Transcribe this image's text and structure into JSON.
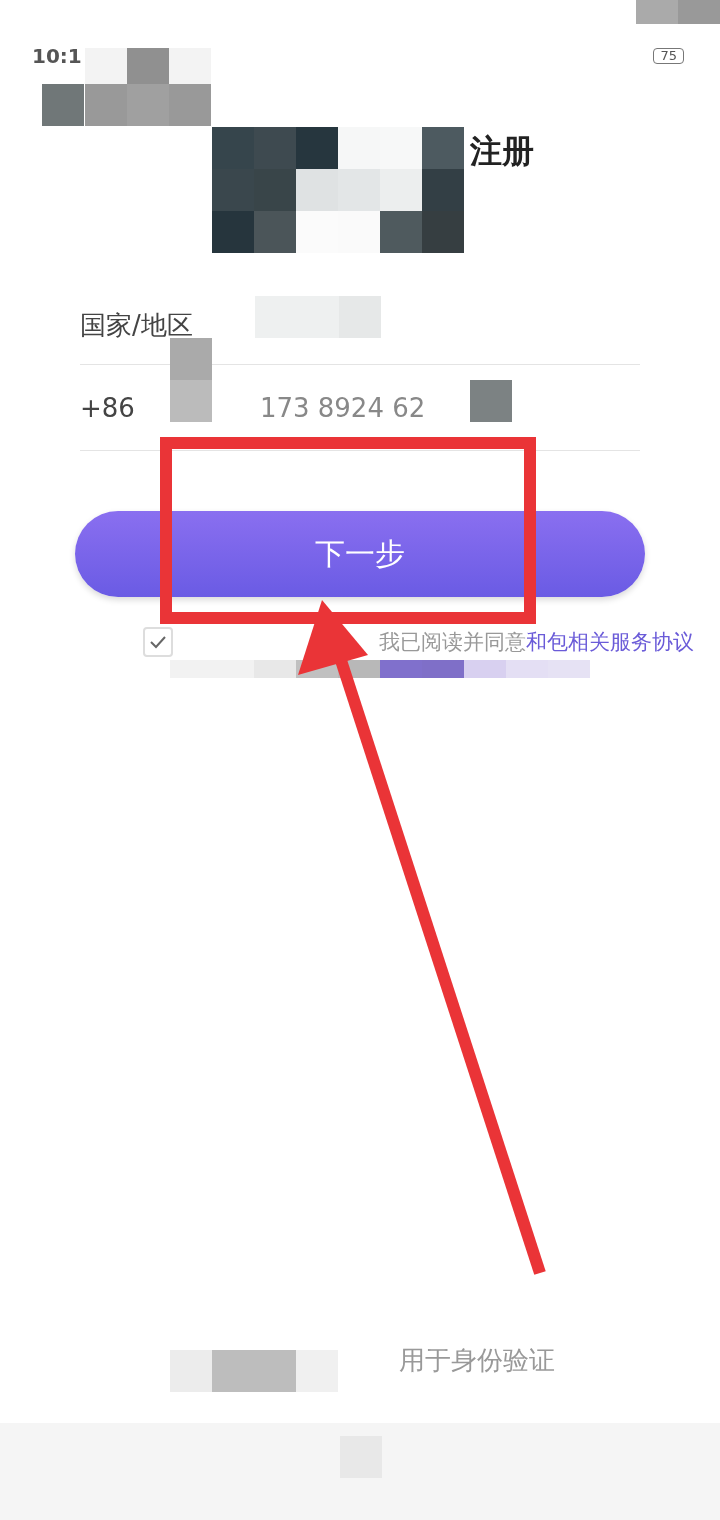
{
  "status_bar": {
    "time": "10:1",
    "battery": "75"
  },
  "title": "注册",
  "form": {
    "rows": [
      {
        "kind": "label",
        "label": "国家/地区"
      },
      {
        "kind": "phone",
        "prefix": "+86",
        "value": "173 8924 62"
      }
    ]
  },
  "next_button": "下一步",
  "agreement": {
    "checked": true,
    "text": "我已阅读并同意",
    "link": "和包相关服务协议"
  },
  "footer_note": "用于身份验证"
}
